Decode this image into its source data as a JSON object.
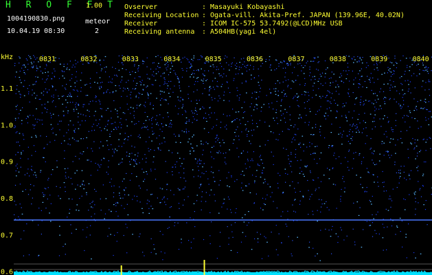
{
  "app": {
    "name": "H R O F F T",
    "version": "1.00"
  },
  "file": {
    "name": "1004190830.png",
    "datetime": "10.04.19 08:30"
  },
  "meteor": {
    "label": "meteor",
    "count": "2"
  },
  "info": [
    {
      "key": "Ovserver",
      "value": "Masayuki Kobayashi"
    },
    {
      "key": "Receiving Location",
      "value": "Ogata-vill. Akita-Pref. JAPAN (139.96E, 40.02N)"
    },
    {
      "key": "Receiver",
      "value": "ICOM IC-575 53.7492(@LCD)MHz USB"
    },
    {
      "key": "Receiving antenna",
      "value": "A504HB(yagi 4el)"
    }
  ],
  "colors": {
    "text_green": "#33ff33",
    "text_yellow": "#ffff33",
    "background": "#000000",
    "noise": "#1a3cff",
    "trace": "#00e0ff",
    "meteor": "#ffff33"
  },
  "chart_data": {
    "type": "heatmap",
    "ylabel": "kHz",
    "yticks": [
      1.1,
      1.0,
      0.9,
      0.8,
      0.7,
      0.6
    ],
    "ylim": [
      0.59,
      1.19
    ],
    "xticks": [
      "0831",
      "0832",
      "0833",
      "0834",
      "0835",
      "0836",
      "0837",
      "0838",
      "0839",
      "0840"
    ],
    "carrier_line_khz": 0.74,
    "meteor_events_time": [
      "0832.8",
      "0834.8"
    ]
  }
}
